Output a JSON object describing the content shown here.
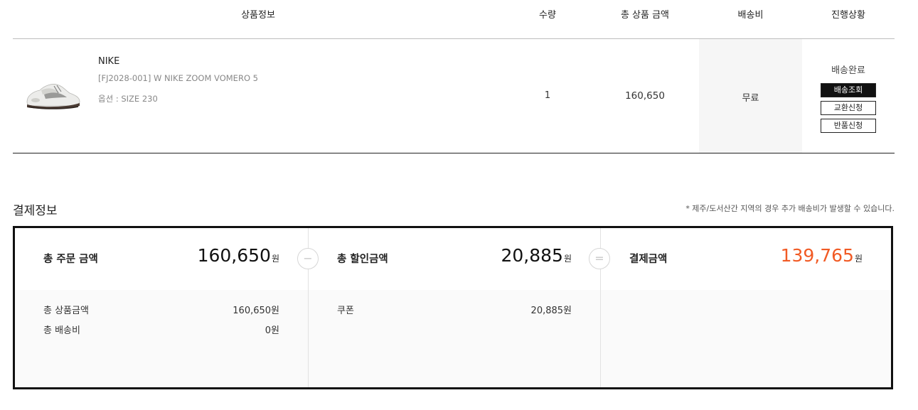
{
  "table": {
    "headers": {
      "info": "상품정보",
      "qty": "수량",
      "total": "총 상품 금액",
      "shipping": "배송비",
      "status": "진행상황"
    },
    "row": {
      "brand": "NIKE",
      "name": "[FJ2028-001] W NIKE ZOOM VOMERO 5",
      "option": "옵션 : SIZE 230",
      "qty": "1",
      "total": "160,650",
      "shipping": "무료",
      "status": "배송완료",
      "buttons": {
        "track": "배송조회",
        "exchange": "교환신청",
        "return": "반품신청"
      }
    }
  },
  "payment": {
    "title": "결제정보",
    "note": "* 제주/도서산간 지역의 경우 추가 배송비가 발생할 수 있습니다.",
    "order_total": {
      "label": "총 주문 금액",
      "amount": "160,650",
      "unit": "원"
    },
    "discount_total": {
      "label": "총 할인금액",
      "amount": "20,885",
      "unit": "원"
    },
    "final_total": {
      "label": "결제금액",
      "amount": "139,765",
      "unit": "원"
    },
    "order_details": [
      {
        "label": "총 상품금액",
        "value": "160,650원"
      },
      {
        "label": "총 배송비",
        "value": "0원"
      }
    ],
    "discount_details": [
      {
        "label": "쿠폰",
        "value": "20,885원"
      }
    ],
    "operators": {
      "minus": "−",
      "equals": "="
    }
  },
  "colors": {
    "accent": "#f15a24",
    "border_dark": "#111111",
    "shipping_bg": "#f6f6f6"
  },
  "icons": {
    "product": "sneaker-image"
  }
}
